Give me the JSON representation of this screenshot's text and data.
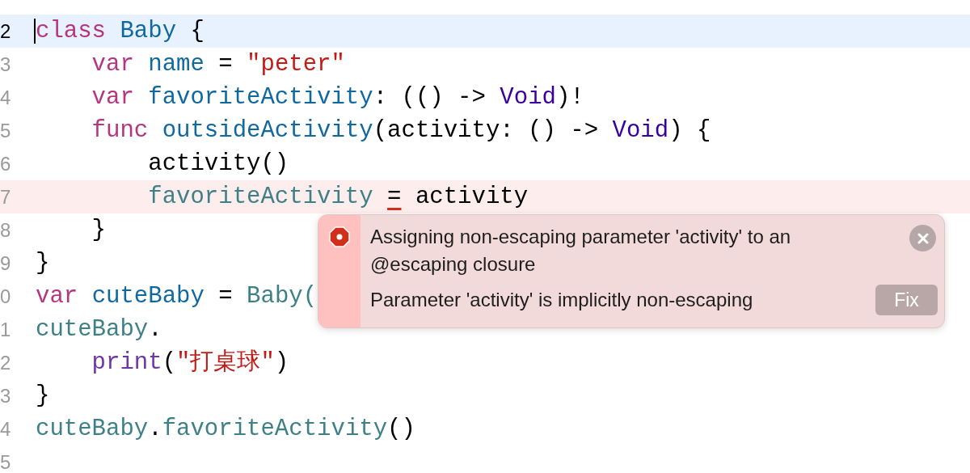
{
  "lines": [
    {
      "number": "2",
      "current": true,
      "caret": true,
      "tokens": [
        {
          "text": "class ",
          "kind": "keyword"
        },
        {
          "text": "Baby",
          "kind": "declaration"
        },
        {
          "text": " {",
          "kind": "plain"
        }
      ]
    },
    {
      "number": "3",
      "tokens": [
        {
          "text": "    var ",
          "kind": "keyword"
        },
        {
          "text": "name",
          "kind": "declaration"
        },
        {
          "text": " = ",
          "kind": "plain"
        },
        {
          "text": "\"peter\"",
          "kind": "string"
        }
      ]
    },
    {
      "number": "4",
      "tokens": [
        {
          "text": "    var ",
          "kind": "keyword"
        },
        {
          "text": "favoriteActivity",
          "kind": "declaration"
        },
        {
          "text": ": (() -> ",
          "kind": "plain"
        },
        {
          "text": "Void",
          "kind": "type"
        },
        {
          "text": ")!",
          "kind": "plain"
        }
      ]
    },
    {
      "number": "5",
      "tokens": [
        {
          "text": "    func ",
          "kind": "keyword"
        },
        {
          "text": "outsideActivity",
          "kind": "declaration"
        },
        {
          "text": "(activity: () -> ",
          "kind": "plain"
        },
        {
          "text": "Void",
          "kind": "type"
        },
        {
          "text": ") {",
          "kind": "plain"
        }
      ]
    },
    {
      "number": "6",
      "tokens": [
        {
          "text": "        activity()",
          "kind": "plain"
        }
      ]
    },
    {
      "number": "7",
      "flagged": true,
      "tokens": [
        {
          "text": "        favoriteActivity ",
          "kind": "reference"
        },
        {
          "text": "=",
          "kind": "flagged"
        },
        {
          "text": " activity",
          "kind": "plain"
        }
      ]
    },
    {
      "number": "8",
      "tokens": [
        {
          "text": "    }",
          "kind": "plain"
        }
      ]
    },
    {
      "number": "9",
      "tokens": [
        {
          "text": "}",
          "kind": "plain"
        }
      ]
    },
    {
      "number": "0",
      "tokens": [
        {
          "text": "var ",
          "kind": "keyword"
        },
        {
          "text": "cuteBaby",
          "kind": "declaration"
        },
        {
          "text": " = ",
          "kind": "plain"
        },
        {
          "text": "Baby(",
          "kind": "reference"
        }
      ]
    },
    {
      "number": "1",
      "tokens": [
        {
          "text": "cuteBaby",
          "kind": "reference"
        },
        {
          "text": ".",
          "kind": "plain"
        }
      ]
    },
    {
      "number": "2",
      "tokens": [
        {
          "text": "    print",
          "kind": "builtin"
        },
        {
          "text": "(",
          "kind": "plain"
        },
        {
          "text": "\"打桌球\"",
          "kind": "string"
        },
        {
          "text": ")",
          "kind": "plain"
        }
      ]
    },
    {
      "number": "3",
      "tokens": [
        {
          "text": "}",
          "kind": "plain"
        }
      ]
    },
    {
      "number": "4",
      "tokens": [
        {
          "text": "cuteBaby",
          "kind": "reference"
        },
        {
          "text": ".",
          "kind": "plain"
        },
        {
          "text": "favoriteActivity",
          "kind": "reference"
        },
        {
          "text": "()",
          "kind": "plain"
        }
      ]
    },
    {
      "number": "5"
    }
  ],
  "issue": {
    "message": "Assigning non-escaping parameter 'activity' to an @escaping closure",
    "note": "Parameter 'activity' is implicitly non-escaping",
    "fix_button": "Fix"
  }
}
